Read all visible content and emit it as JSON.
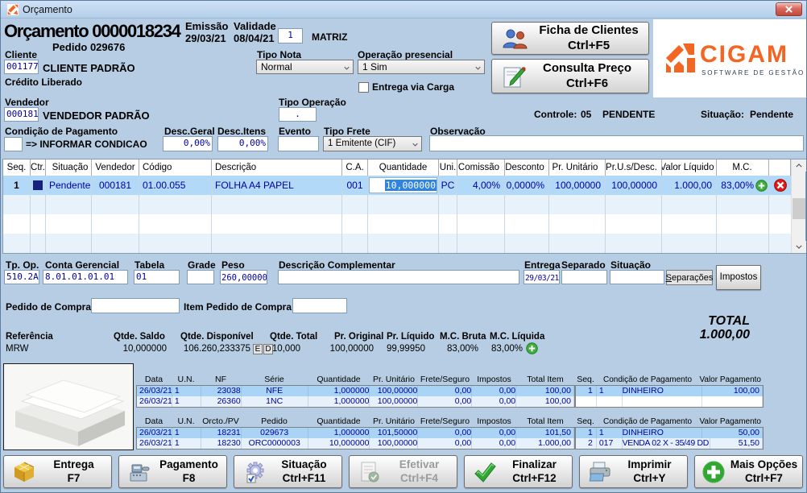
{
  "window": {
    "title": "Orçamento"
  },
  "header": {
    "title": "Orçamento 0000018234",
    "pedido": "Pedido  029676",
    "emissao_label": "Emissão",
    "emissao": "29/03/21",
    "validade_label": "Validade",
    "validade": "08/04/21",
    "matriz": "1",
    "matriz_label": "MATRIZ",
    "cliente_label": "Cliente",
    "cliente_code": "001177",
    "cliente_name": "CLIENTE PADRÃO",
    "credito": "Crédito Liberado",
    "tipo_nota_label": "Tipo Nota",
    "tipo_nota": "Normal",
    "operacao_label": "Operação presencial",
    "operacao": "1 Sim",
    "entrega_carga": "Entrega via Carga",
    "vendedor_label": "Vendedor",
    "vendedor_code": "000181",
    "vendedor_name": "VENDEDOR PADRÃO",
    "tipo_oper_label": "Tipo Operação",
    "tipo_oper": ".",
    "controle_label": "Controle:",
    "controle_num": "05",
    "controle_status": "PENDENTE",
    "situacao_label": "Situação:",
    "situacao": "Pendente",
    "cond_label": "Condição de Pagamento",
    "cond_msg": "=> INFORMAR CONDICAO",
    "desc_geral_label": "Desc.Geral",
    "desc_geral": "0,00%",
    "desc_itens_label": "Desc.Itens",
    "desc_itens": "0,00%",
    "evento_label": "Evento",
    "tipo_frete_label": "Tipo Frete",
    "tipo_frete": "1 Emitente (CIF)",
    "obs_label": "Observação",
    "ficha_btn": "Ficha de Clientes",
    "ficha_key": "Ctrl+F5",
    "consulta_btn": "Consulta Preço",
    "consulta_key": "Ctrl+F6",
    "logo_text": "CIGAM",
    "logo_sub": "SOFTWARE DE GESTÃO"
  },
  "grid": {
    "columns": [
      "Seq.",
      "Ctr.",
      "Situação",
      "Vendedor",
      "Código",
      "Descrição",
      "C.A.",
      "Quantidade",
      "Uni.",
      "Comissão",
      "Desconto",
      "Pr. Unitário",
      "Pr.U.s/Desc.",
      "Valor Líquido",
      "M.C."
    ],
    "row": {
      "seq": "1",
      "situacao": "Pendente",
      "vendedor": "000181",
      "codigo": "01.00.055",
      "descricao": "FOLHA A4 PAPEL",
      "ca": "001",
      "qtde": "10,000000",
      "uni": "PC",
      "comissao": "4,00%",
      "desconto": "0,0000%",
      "pr_unit": "100,00000",
      "pr_usdesc": "100,00000",
      "valor_liq": "1.000,00",
      "mc": "83,00%"
    }
  },
  "detail": {
    "tp_op_label": "Tp. Op.",
    "tp_op": "510.2A",
    "conta_label": "Conta Gerencial",
    "conta": "8.01.01.01.01",
    "tabela_label": "Tabela",
    "tabela": "01",
    "grade_label": "Grade",
    "peso_label": "Peso",
    "peso": "260,00000",
    "desc_comp_label": "Descrição Complementar",
    "entrega_label": "Entrega",
    "entrega": "29/03/21",
    "separado_label": "Separado",
    "situacao_label": "Situação",
    "separacoes_s": "S",
    "separacoes_rest": "eparações",
    "impostos": "Impostos",
    "ped_compra_label": "Pedido de Compra",
    "item_ped_label": "Item Pedido de Compra",
    "ref_label": "Referência",
    "ref": "MRW",
    "saldo_label": "Qtde. Saldo",
    "saldo": "10,000000",
    "disp_label": "Qtde. Disponível",
    "disp": "106.260,233375",
    "e": "E",
    "d": "D",
    "qtotal_label": "Qtde. Total",
    "qtotal": "10,000",
    "pr_orig_label": "Pr. Original",
    "pr_orig": "100,00000",
    "pr_liq_label": "Pr. Líquido",
    "pr_liq": "99,99950",
    "mc_bruta_label": "M.C. Bruta",
    "mc_bruta": "83,00%",
    "mc_liq_label": "M.C. Líquida",
    "mc_liq": "83,00%",
    "total_label": "TOTAL",
    "total_val": "1.000,00"
  },
  "nf": {
    "headers": [
      "Data",
      "U.N.",
      "NF",
      "Série",
      "Quantidade",
      "Pr. Unitário",
      "Frete/Seguro",
      "Impostos",
      "Total Item"
    ],
    "rows": [
      [
        "26/03/21",
        "1",
        "23038",
        "NFE",
        "1,000000",
        "100,00000",
        "0,00",
        "0,00",
        "100,00"
      ],
      [
        "26/03/21",
        "1",
        "26360",
        "1NC",
        "1,000000",
        "100,00000",
        "0,00",
        "0,00",
        "100,00"
      ]
    ]
  },
  "pv": {
    "headers": [
      "Data",
      "U.N.",
      "Orcto./PV",
      "Pedido",
      "Quantidade",
      "Pr. Unitário",
      "Frete/Seguro",
      "Impostos",
      "Total Item"
    ],
    "rows": [
      [
        "26/03/21",
        "1",
        "18231",
        "029673",
        "1,000000",
        "101,50000",
        "0,00",
        "0,00",
        "101,50"
      ],
      [
        "26/03/21",
        "1",
        "18230",
        "ORC0000003",
        "10,000000",
        "100,00000",
        "0,00",
        "0,00",
        "1.000,00"
      ]
    ]
  },
  "pag1": {
    "headers": [
      "Seq.",
      "Condição de Pagamento",
      "Valor Pagamento"
    ],
    "rows": [
      [
        "1",
        "1",
        "DINHEIRO",
        "100,00"
      ],
      [
        "",
        "",
        "",
        ""
      ]
    ]
  },
  "pag2": {
    "headers": [
      "Seq.",
      "Condição de Pagamento",
      "Valor Pagamento"
    ],
    "rows": [
      [
        "1",
        "1",
        "DINHEIRO",
        "50,00"
      ],
      [
        "2",
        "017",
        "VENDA 02 X - 35/49 DD",
        "51,50"
      ]
    ]
  },
  "footer": [
    {
      "label": "Entrega",
      "key": "F7"
    },
    {
      "label": "Pagamento",
      "key": "F8"
    },
    {
      "label": "Situação",
      "key": "Ctrl+F11"
    },
    {
      "label": "Efetivar",
      "key": "Ctrl+F4"
    },
    {
      "label": "Finalizar",
      "key": "Ctrl+F12"
    },
    {
      "label": "Imprimir",
      "key": "Ctrl+Y"
    },
    {
      "label": "Mais Opções",
      "key": "Ctrl+F7"
    }
  ]
}
